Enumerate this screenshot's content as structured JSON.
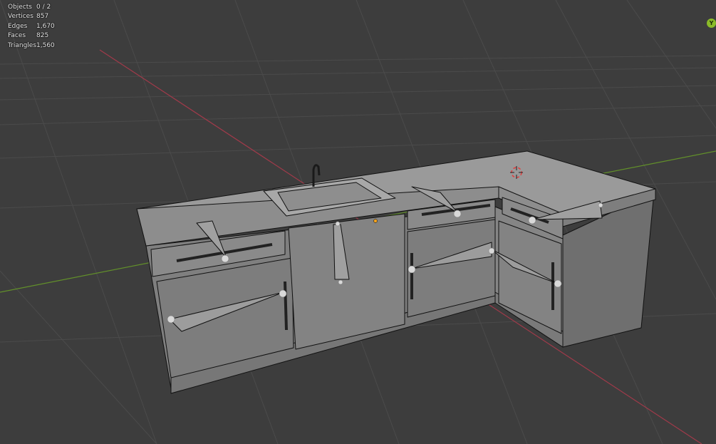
{
  "stats": [
    {
      "label": "Objects",
      "value": "0 / 2"
    },
    {
      "label": "Vertices",
      "value": "857"
    },
    {
      "label": "Edges",
      "value": "1,670"
    },
    {
      "label": "Faces",
      "value": "825"
    },
    {
      "label": "Triangles",
      "value": "1,560"
    }
  ],
  "gizmo": {
    "axis_label": "Y"
  },
  "colors": {
    "background": "#3d3d3d",
    "grid": "#4a4a4a",
    "x_axis": "#a13a4a",
    "y_axis": "#62902a",
    "mesh_face": "#8a8a8a",
    "mesh_edge": "#111111",
    "origin_dot": "#f2a21c"
  }
}
